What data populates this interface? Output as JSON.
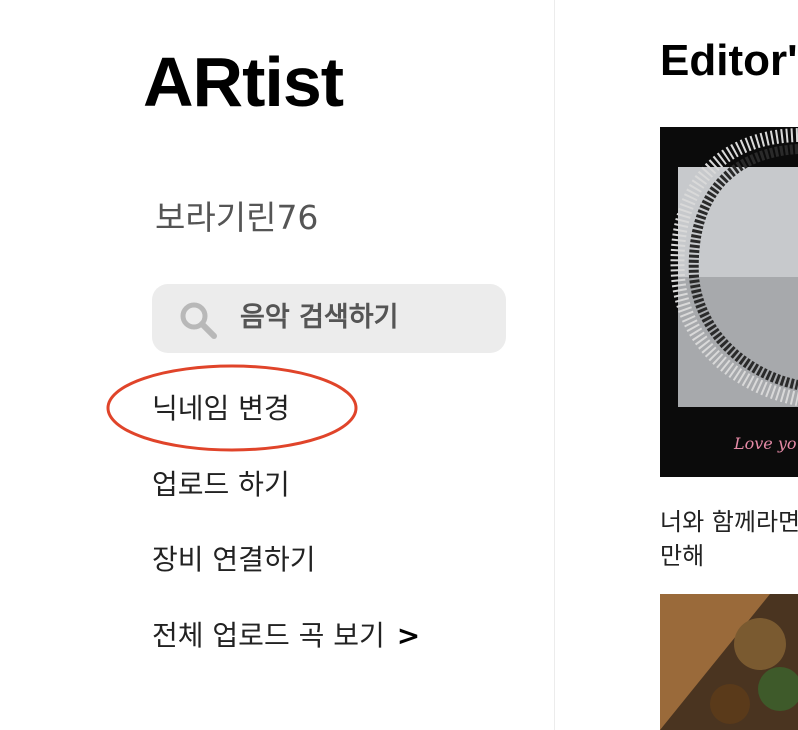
{
  "sidebar": {
    "logo": "ARtist",
    "username": "보라기린76",
    "search": {
      "placeholder": "음악 검색하기"
    },
    "menu": {
      "change_nickname": "닉네임 변경",
      "upload": "업로드 하기",
      "connect_device": "장비 연결하기",
      "view_all_uploads": "전체 업로드 곡 보기",
      "view_all_arrow": ">"
    }
  },
  "main": {
    "section_title": "Editor's",
    "cards": [
      {
        "image_text": "Love yo",
        "caption_line1": "너와 함께라면",
        "caption_line2": "만해"
      }
    ]
  },
  "colors": {
    "highlight_circle": "#e0442a",
    "search_bg": "#ececec",
    "username_text": "#555555"
  },
  "icons": {
    "search": "search-icon"
  }
}
